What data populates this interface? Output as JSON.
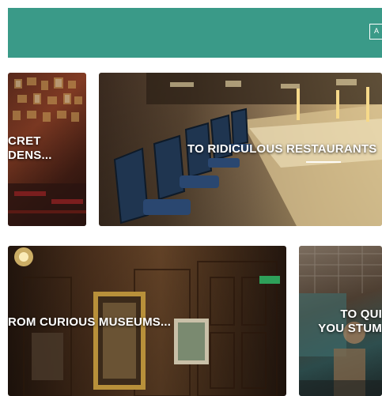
{
  "header": {
    "button_label": "A",
    "accent_color": "#3a9a88"
  },
  "tiles": [
    {
      "id": "secret-gardens",
      "caption_lines": [
        "CRET",
        "DENS..."
      ]
    },
    {
      "id": "restaurants",
      "caption": "TO RIDICULOUS RESTAURANTS"
    },
    {
      "id": "museums",
      "caption": "ROM CURIOUS MUSEUMS..."
    },
    {
      "id": "quirky",
      "caption_lines": [
        "TO QUI",
        "YOU STUM"
      ]
    }
  ]
}
